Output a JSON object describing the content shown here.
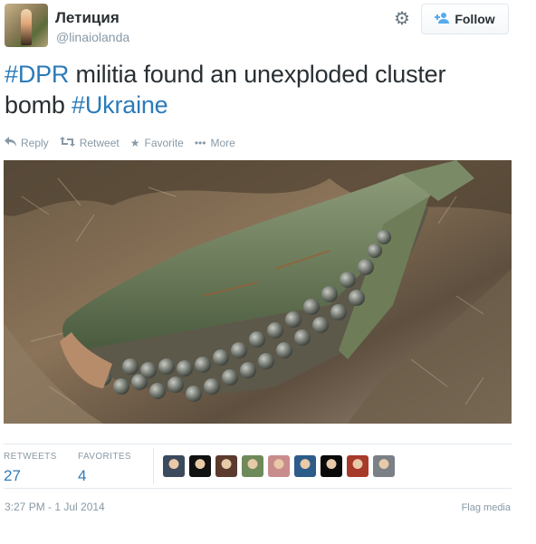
{
  "user": {
    "name": "Летиция",
    "handle": "@linaiolanda"
  },
  "header": {
    "follow_label": "Follow"
  },
  "tweet": {
    "segments": [
      {
        "text": "#DPR",
        "type": "hashtag"
      },
      {
        "text": " militia found an unexploded cluster bomb ",
        "type": "text"
      },
      {
        "text": "#Ukraine",
        "type": "hashtag"
      }
    ]
  },
  "actions": {
    "reply": "Reply",
    "retweet": "Retweet",
    "favorite": "Favorite",
    "more": "More"
  },
  "stats": {
    "retweets_label": "RETWEETS",
    "retweets_value": "27",
    "favorites_label": "FAVORITES",
    "favorites_value": "4"
  },
  "favoriters": [
    {
      "color": "#3b4a5c"
    },
    {
      "color": "#111111"
    },
    {
      "color": "#5a3b2e"
    },
    {
      "color": "#6f8a5a"
    },
    {
      "color": "#c98c8c"
    },
    {
      "color": "#2d5c8a"
    },
    {
      "color": "#0a0a0a"
    },
    {
      "color": "#a83a2a"
    },
    {
      "color": "#7b7f86"
    }
  ],
  "footer": {
    "timestamp": "3:27 PM - 1 Jul 2014",
    "flag": "Flag media"
  },
  "colors": {
    "link": "#2b7bb9",
    "muted": "#8899a6",
    "text": "#292f33"
  }
}
